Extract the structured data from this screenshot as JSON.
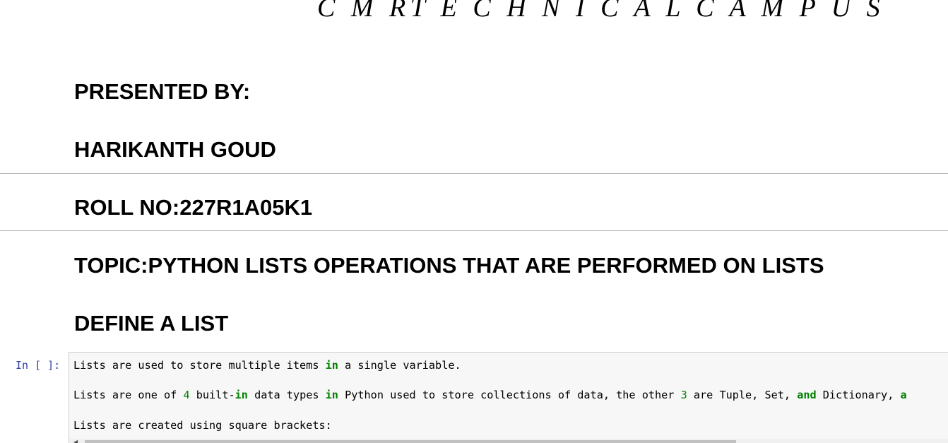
{
  "notebook": {
    "top_title": "C M RT E C H N I C A L C A M P U S",
    "headings": {
      "presented_by": "PRESENTED BY:",
      "name": "HARIKANTH GOUD",
      "roll": "ROLL NO:227R1A05K1",
      "topic": "TOPIC:PYTHON LISTS OPERATIONS THAT ARE PERFORMED ON LISTS",
      "define": "DEFINE A LIST"
    },
    "cell": {
      "prompt": "In [ ]:",
      "line1": [
        {
          "t": "Lists are used to store multiple items ",
          "c": ""
        },
        {
          "t": "in",
          "c": "kw"
        },
        {
          "t": " a single variable.",
          "c": ""
        }
      ],
      "line2": [
        {
          "t": "Lists are one of ",
          "c": ""
        },
        {
          "t": "4",
          "c": "num"
        },
        {
          "t": " built-",
          "c": ""
        },
        {
          "t": "in",
          "c": "kw"
        },
        {
          "t": " data types ",
          "c": ""
        },
        {
          "t": "in",
          "c": "kw"
        },
        {
          "t": " Python used to store collections of data, the other ",
          "c": ""
        },
        {
          "t": "3",
          "c": "num"
        },
        {
          "t": " are Tuple, Set, ",
          "c": ""
        },
        {
          "t": "and",
          "c": "kw"
        },
        {
          "t": " Dictionary, ",
          "c": ""
        },
        {
          "t": "a",
          "c": "kw"
        }
      ],
      "line3": [
        {
          "t": "Lists are created using square brackets:",
          "c": ""
        }
      ]
    },
    "icons": {
      "scroll_left": "chevron-left-icon"
    }
  }
}
